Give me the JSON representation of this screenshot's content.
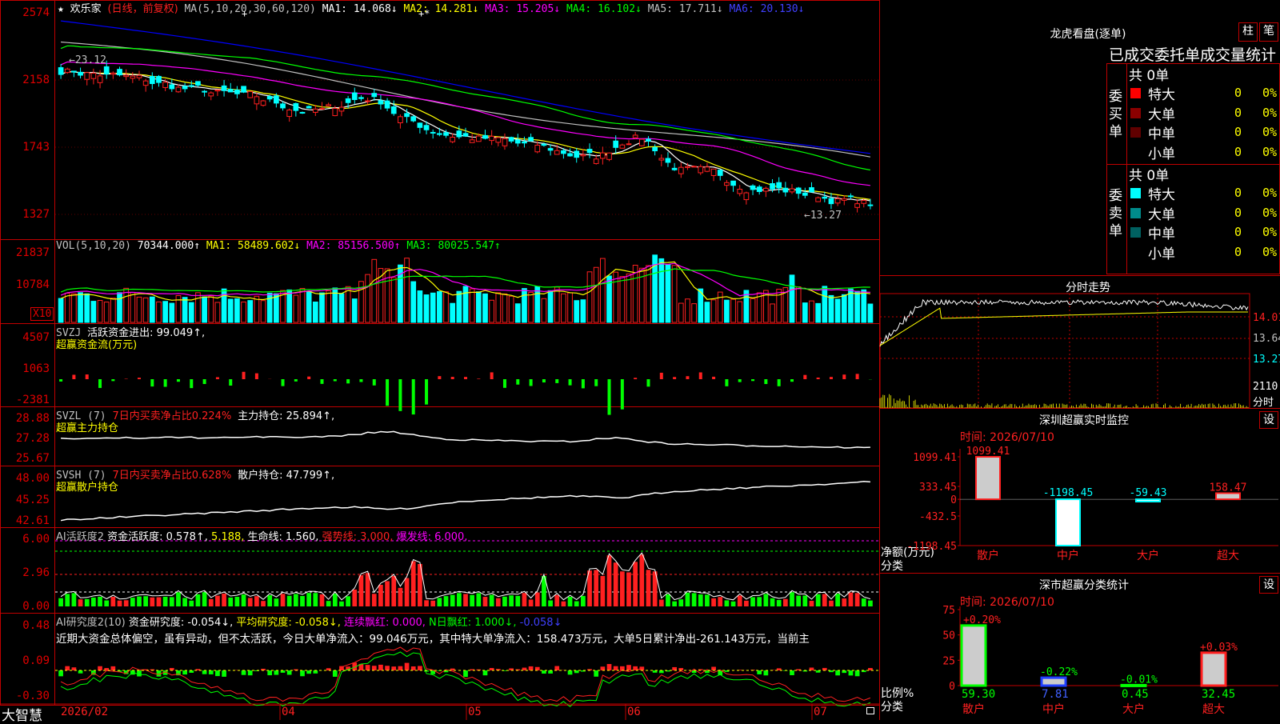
{
  "colors": {
    "up": "#ff2020",
    "down": "#00ffff",
    "bg": "#000000",
    "grid": "#c00000",
    "ma1": "#ffffff",
    "ma2": "#ffff00",
    "ma3": "#ff00ff",
    "ma4": "#00ff00",
    "ma5": "#c0c0c0",
    "ma6": "#0000ff"
  },
  "main": {
    "star": "★",
    "stock_name": "欢乐家",
    "period": "(日线，前复权)",
    "ma_params": "MA(5,10,20,30,60,120)",
    "ma1": "MA1: 14.068↓",
    "ma2": "MA2: 14.281↓",
    "ma3": "MA3: 15.205↓",
    "ma4": "MA4: 16.102↓",
    "ma5": "MA5: 17.711↓",
    "ma6": "MA6: 20.130↓",
    "yticks": [
      "2574",
      "2158",
      "1743",
      "1327"
    ],
    "high_mark": "←23.12",
    "low_mark": "←13.27",
    "event_marks": [
      "+",
      "+*"
    ]
  },
  "vol": {
    "title": "VOL(5,10,20)",
    "value": "70344.000↑",
    "ma1": "MA1: 58489.602↓",
    "ma2": "MA2: 85156.500↑",
    "ma3": "MA3: 80025.547↑",
    "yticks": [
      "21837",
      "10784"
    ],
    "unit": "X10"
  },
  "svzj": {
    "title": "SVZJ",
    "label": "活跃资金进出: 99.049↑,",
    "sub": "超赢资金流(万元)",
    "yticks": [
      "4507",
      "1063",
      "-2381"
    ]
  },
  "svzl": {
    "title": "SVZL (7)",
    "ratio": "7日内买卖净占比0.224%",
    "hold": "主力持仓: 25.894↑,",
    "sub": "超赢主力持仓",
    "yticks": [
      "28.88",
      "27.28",
      "25.67"
    ]
  },
  "svsh": {
    "title": "SVSH (7)",
    "ratio": "7日内买卖净占比0.628%",
    "hold": "散户持仓: 47.799↑,",
    "sub": "超赢散户持仓",
    "yticks": [
      "48.00",
      "45.25",
      "42.61"
    ]
  },
  "ai1": {
    "title": "AI活跃度2",
    "a": "资金活跃度: 0.578↑,",
    "b": "5.188,",
    "c": "生命线: 1.560,",
    "d": "强势线: 3.000,",
    "e": "爆发线: 6.000,",
    "yticks": [
      "6.00",
      "2.96",
      "0.00"
    ]
  },
  "ai2": {
    "title": "AI研究度2(10)",
    "a": "资金研究度: -0.054↓,",
    "b": "平均研究度: -0.058↓,",
    "c": "连续飘红: 0.000,",
    "d": "N日飘红: 1.000↓,",
    "e": "-0.058↓",
    "desc": "近期大资金总体偏空，虽有异动，但不太活跃，今日大单净流入：99.046万元，其中特大单净流入：158.473万元，大单5日累计净出-261.143万元，当前主",
    "yticks": [
      "0.48",
      "0.09",
      "-0.30"
    ]
  },
  "xaxis": {
    "labels": [
      "2026/02",
      "04",
      "05",
      "06",
      "07"
    ],
    "logo": "大智慧"
  },
  "right": {
    "lhkp": {
      "title": "龙虎看盘(逐单)",
      "btn1": "柱",
      "btn2": "笔",
      "subtitle": "已成交委托单成交量统计",
      "buy_side": "委买单",
      "sell_side": "委卖单",
      "buy_total": "共 0单",
      "sell_total": "共 0单",
      "buy_rows": [
        {
          "label": "特大",
          "value": "0",
          "pct": "0%",
          "color": "#ff0000"
        },
        {
          "label": "大单",
          "value": "0",
          "pct": "0%",
          "color": "#8b0000"
        },
        {
          "label": "中单",
          "value": "0",
          "pct": "0%",
          "color": "#600000"
        },
        {
          "label": "小单",
          "value": "0",
          "pct": "0%",
          "color": ""
        }
      ],
      "sell_rows": [
        {
          "label": "特大",
          "value": "0",
          "pct": "0%",
          "color": "#00ffff"
        },
        {
          "label": "大单",
          "value": "0",
          "pct": "0%",
          "color": "#008b8b"
        },
        {
          "label": "中单",
          "value": "0",
          "pct": "0%",
          "color": "#006060"
        },
        {
          "label": "小单",
          "value": "0",
          "pct": "0%",
          "color": ""
        }
      ]
    },
    "intraday": {
      "title": "分时走势",
      "yticks": [
        "14.01",
        "13.64",
        "13.27"
      ],
      "vol_tick": "2110",
      "vol_unit": "分时"
    },
    "sz_monitor": {
      "title": "深圳超赢实时监控",
      "btn": "设",
      "time": "时间: 2026/07/10",
      "yticks": [
        "1099.41",
        "333.45",
        "0",
        "-432.5",
        "-1198.45"
      ],
      "ylabel": "净额(万元)",
      "xlabel": "分类",
      "categories": [
        "散户",
        "中户",
        "大户",
        "超大"
      ],
      "value_labels": [
        "1099.41",
        "-1198.45",
        "-59.43",
        "158.47"
      ]
    },
    "sz_classify": {
      "title": "深市超赢分类统计",
      "btn": "设",
      "time": "时间: 2026/07/10",
      "yticks": [
        "75",
        "50",
        "25",
        "0"
      ],
      "ylabel": "比例%",
      "xlabel": "分类",
      "categories": [
        "散户",
        "中户",
        "大户",
        "超大"
      ],
      "change_labels": [
        "+0.20%",
        "-0.22%",
        "-0.01%",
        "+0.03%"
      ],
      "value_labels": [
        "59.30",
        "7.81",
        "0.45",
        "32.45"
      ]
    }
  },
  "chart_data": [
    {
      "type": "bar",
      "title": "深圳超赢实时监控",
      "ylabel": "净额(万元)",
      "xlabel": "分类",
      "categories": [
        "散户",
        "中户",
        "大户",
        "超大"
      ],
      "values": [
        1099.41,
        -1198.45,
        -59.43,
        158.47
      ],
      "ylim": [
        -1198.45,
        1099.41
      ]
    },
    {
      "type": "bar",
      "title": "深市超赢分类统计",
      "ylabel": "比例%",
      "xlabel": "分类",
      "categories": [
        "散户",
        "中户",
        "大户",
        "超大"
      ],
      "values": [
        59.3,
        7.81,
        0.45,
        32.45
      ],
      "ylim": [
        0,
        75
      ]
    }
  ]
}
